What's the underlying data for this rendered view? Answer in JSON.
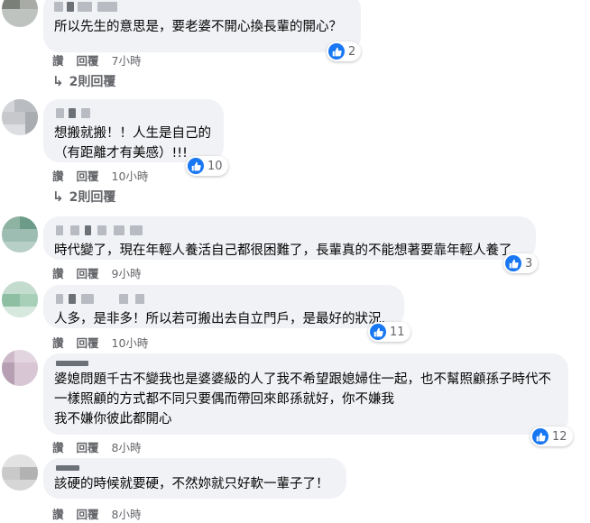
{
  "comments": [
    {
      "text": "所以先生的意思是，要老婆不開心換長輩的開心？",
      "likes": "2",
      "actions": {
        "like": "讚",
        "reply": "回覆",
        "time": "7小時"
      },
      "replies_label": "2則回覆"
    },
    {
      "text": "想搬就搬！！人生是自己的\n（有距離才有美感）!!!",
      "likes": "10",
      "actions": {
        "like": "讚",
        "reply": "回覆",
        "time": "10小時"
      },
      "replies_label": "2則回覆"
    },
    {
      "text": "時代變了，現在年輕人養活自己都很困難了，長輩真的不能想著要靠年輕人養了",
      "likes": "3",
      "actions": {
        "like": "讚",
        "reply": "回覆",
        "time": "9小時"
      }
    },
    {
      "text": "人多，是非多！所以若可搬出去自立門戶，是最好的狀況.",
      "likes": "11",
      "actions": {
        "like": "讚",
        "reply": "回覆",
        "time": "10小時"
      }
    },
    {
      "text": "婆媳問題千古不變我也是婆婆級的人了我不希望跟媳婦住一起，也不幫照顧孫子時代不一樣照顧的方式都不同只要偶而帶回來郎孫就好，你不嫌我\n我不嫌你彼此都開心",
      "likes": "12",
      "actions": {
        "like": "讚",
        "reply": "回覆",
        "time": "8小時"
      }
    },
    {
      "text": "該硬的時候就要硬，不然妳就只好軟一輩子了！",
      "likes": "",
      "actions": {
        "like": "讚",
        "reply": "回覆",
        "time": "8小時"
      }
    }
  ],
  "colors": {
    "like_blue": "#1877f2",
    "bubble_bg": "#f0f2f5",
    "meta_gray": "#65676b"
  },
  "icons": {
    "like": "thumbs-up-icon",
    "reply_arrow": "reply-arrow-icon"
  }
}
